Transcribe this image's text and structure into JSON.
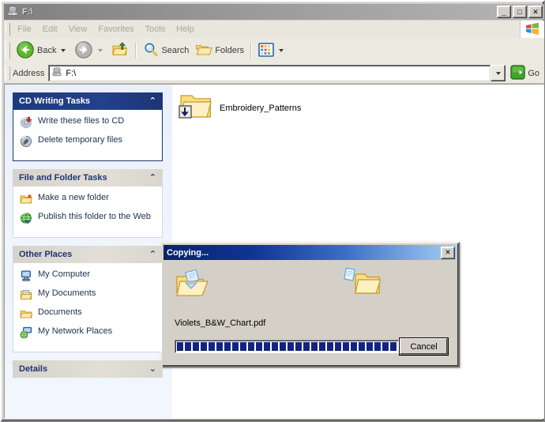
{
  "window": {
    "title": "F:\\",
    "title_icon": "drive-icon",
    "controls": {
      "minimize": "_",
      "maximize": "□",
      "close": "✕"
    }
  },
  "menu": {
    "items": [
      {
        "label": "File"
      },
      {
        "label": "Edit"
      },
      {
        "label": "View"
      },
      {
        "label": "Favorites"
      },
      {
        "label": "Tools"
      },
      {
        "label": "Help"
      }
    ],
    "brand_icon": "windows-flag-icon"
  },
  "toolbar": {
    "back_label": "Back",
    "back_icon": "back-arrow-icon",
    "forward_icon": "forward-arrow-icon",
    "up_icon": "up-folder-icon",
    "search_label": "Search",
    "search_icon": "magnifier-icon",
    "folders_label": "Folders",
    "folders_icon": "folders-icon",
    "views_icon": "views-icon"
  },
  "address": {
    "label": "Address",
    "value": "F:\\",
    "icon": "drive-icon",
    "dropdown_icon": "chevron-down-icon",
    "go_label": "Go",
    "go_icon": "green-go-arrow-icon"
  },
  "sidebar": {
    "panels": [
      {
        "title": "CD Writing Tasks",
        "style": "blue",
        "chevron": "⌃",
        "collapsed": false,
        "items": [
          {
            "label": "Write these files to CD",
            "icon": "cd-write-icon"
          },
          {
            "label": "Delete temporary files",
            "icon": "cd-delete-icon"
          }
        ]
      },
      {
        "title": "File and Folder Tasks",
        "style": "gray",
        "chevron": "⌃",
        "collapsed": false,
        "items": [
          {
            "label": "Make a new folder",
            "icon": "new-folder-icon"
          },
          {
            "label": "Publish this folder to the Web",
            "icon": "publish-web-icon"
          }
        ]
      },
      {
        "title": "Other Places",
        "style": "gray",
        "chevron": "⌃",
        "collapsed": false,
        "items": [
          {
            "label": "My Computer",
            "icon": "my-computer-icon"
          },
          {
            "label": "My Documents",
            "icon": "my-documents-icon"
          },
          {
            "label": "Documents",
            "icon": "folder-icon"
          },
          {
            "label": "My Network Places",
            "icon": "network-places-icon"
          }
        ]
      },
      {
        "title": "Details",
        "style": "gray",
        "chevron": "⌄",
        "collapsed": true,
        "items": []
      }
    ]
  },
  "files": [
    {
      "name": "Embroidery_Patterns",
      "icon": "folder-pending-burn-icon"
    }
  ],
  "dialog": {
    "title": "Copying...",
    "close_label": "✕",
    "source_icon": "open-folder-sending-file-icon",
    "destination_icon": "folder-receiving-file-icon",
    "filename": "Violets_B&W_Chart.pdf",
    "progress_blocks_filled": 30,
    "progress_blocks_total": 38,
    "progress_percent": 79,
    "cancel_label": "Cancel"
  },
  "colors": {
    "title_inactive": "#9a9a9a",
    "dialog_title_start": "#0a246a",
    "dialog_title_end": "#a6caf0",
    "panel_blue": "#1d3573",
    "progress_fill": "#12257e",
    "face": "#d4d0c8"
  }
}
